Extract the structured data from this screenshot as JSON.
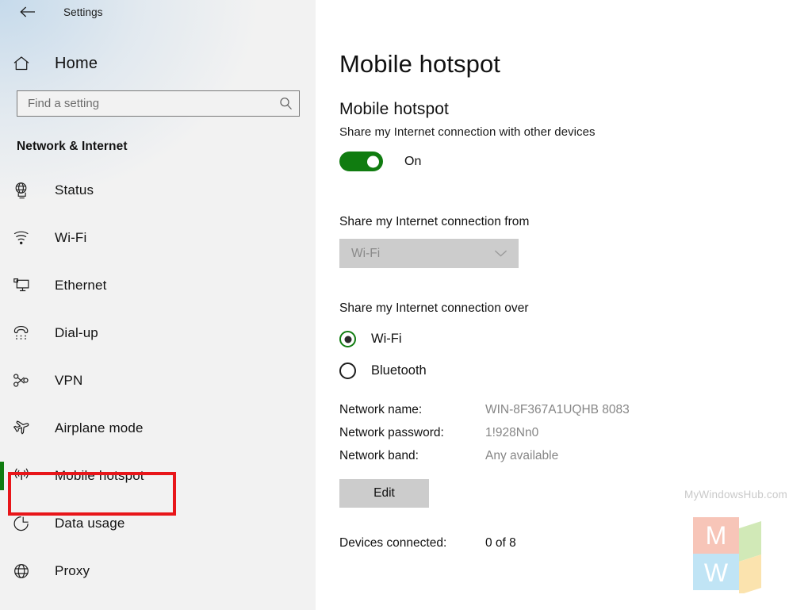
{
  "window": {
    "back_icon": "back-arrow-icon",
    "title": "Settings"
  },
  "sidebar": {
    "home": {
      "label": "Home",
      "icon": "home-icon"
    },
    "search": {
      "placeholder": "Find a setting",
      "value": "",
      "icon": "search-icon"
    },
    "section_heading": "Network & Internet",
    "items": [
      {
        "label": "Status",
        "icon": "globe-monitor-icon",
        "selected": false
      },
      {
        "label": "Wi-Fi",
        "icon": "wifi-icon",
        "selected": false
      },
      {
        "label": "Ethernet",
        "icon": "ethernet-icon",
        "selected": false
      },
      {
        "label": "Dial-up",
        "icon": "dialup-phone-icon",
        "selected": false
      },
      {
        "label": "VPN",
        "icon": "vpn-icon",
        "selected": false
      },
      {
        "label": "Airplane mode",
        "icon": "airplane-icon",
        "selected": false
      },
      {
        "label": "Mobile hotspot",
        "icon": "mobile-hotspot-icon",
        "selected": true
      },
      {
        "label": "Data usage",
        "icon": "pie-chart-icon",
        "selected": false
      },
      {
        "label": "Proxy",
        "icon": "globe-icon",
        "selected": false
      }
    ],
    "selection_accent": "#107c10",
    "annotation_color": "#e8161a"
  },
  "main": {
    "page_title": "Mobile hotspot",
    "group_title": "Mobile hotspot",
    "group_description": "Share my Internet connection with other devices",
    "toggle": {
      "state_label": "On",
      "on": true,
      "accent": "#107c10"
    },
    "share_from": {
      "label": "Share my Internet connection from",
      "selected_option": "Wi-Fi",
      "disabled": true,
      "chevron_icon": "chevron-down-icon"
    },
    "share_over": {
      "label": "Share my Internet connection over",
      "options": [
        {
          "label": "Wi-Fi",
          "checked": true
        },
        {
          "label": "Bluetooth",
          "checked": false
        }
      ]
    },
    "details": [
      {
        "key": "Network name:",
        "value": "WIN-8F367A1UQHB 8083"
      },
      {
        "key": "Network password:",
        "value": "1!928Nn0"
      },
      {
        "key": "Network band:",
        "value": "Any available"
      }
    ],
    "edit_button": "Edit",
    "devices": {
      "key": "Devices connected:",
      "value": "0 of 8"
    }
  },
  "watermark": {
    "text": "MyWindowsHub.com",
    "letters": {
      "top_left": "M",
      "bottom_left": "W"
    },
    "colors": {
      "top_left": "#f3a28e",
      "bottom_left": "#9ad4f0",
      "top_right": "#b6dd8c",
      "bottom_right": "#fad37e"
    }
  }
}
